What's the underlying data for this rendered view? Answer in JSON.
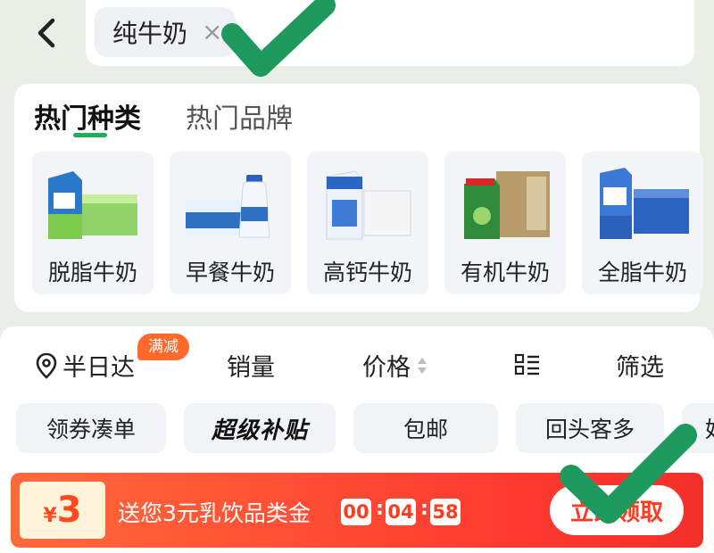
{
  "search": {
    "query": "纯牛奶",
    "clear_symbol": "×"
  },
  "tabs": [
    {
      "label": "热门种类"
    },
    {
      "label": "热门品牌"
    }
  ],
  "categories": [
    {
      "label": "脱脂牛奶"
    },
    {
      "label": "早餐牛奶"
    },
    {
      "label": "高钙牛奶"
    },
    {
      "label": "有机牛奶"
    },
    {
      "label": "全脂牛奶"
    }
  ],
  "sort": {
    "delivery": "半日达",
    "delivery_badge": "满减",
    "sales": "销量",
    "price": "价格",
    "filter": "筛选"
  },
  "pills": [
    {
      "label": "领券凑单"
    },
    {
      "label": "超级补贴"
    },
    {
      "label": "包邮"
    },
    {
      "label": "回头客多"
    },
    {
      "label": "好"
    }
  ],
  "coupon": {
    "currency": "¥",
    "amount": "3",
    "text": "送您3元乳饮品类金",
    "timer": [
      "00",
      "04",
      "58"
    ],
    "claim_label": "立即领取"
  },
  "colors": {
    "accent_green": "#1fae5b",
    "coupon_red": "#ff3b30",
    "badge_orange": "#ff6a2c"
  }
}
